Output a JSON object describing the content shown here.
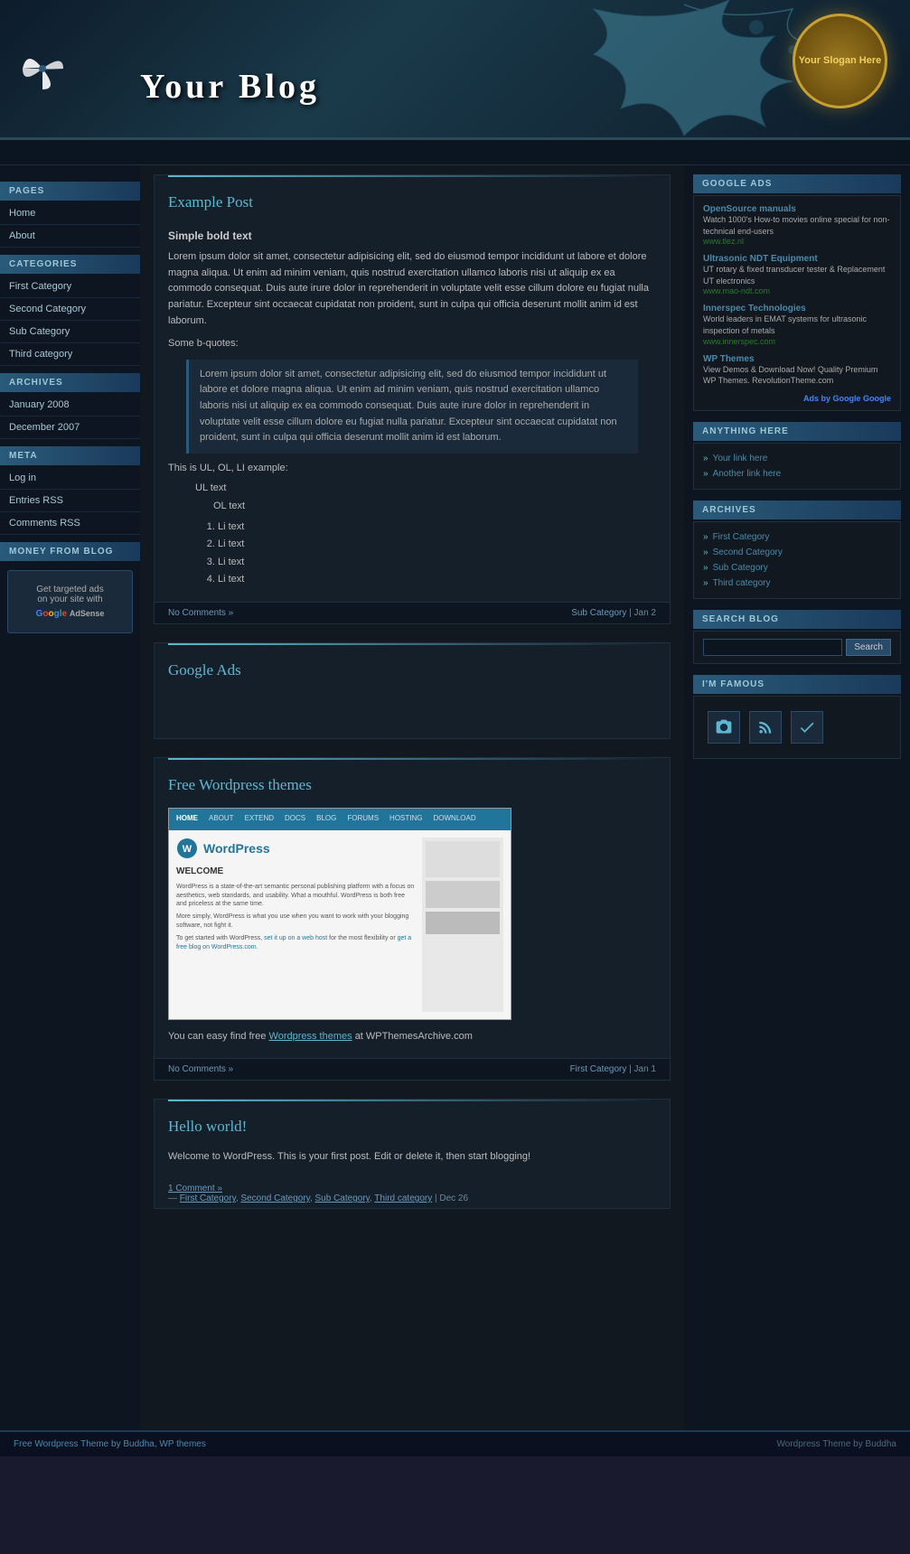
{
  "site": {
    "title": "Your Blog",
    "slogan": "Your\nSlogan\nHere"
  },
  "sidebar": {
    "pages_header": "PAGES",
    "categories_header": "CATEGORIES",
    "archives_header": "ARCHIVES",
    "meta_header": "META",
    "money_header": "MONEY FROM BLOG",
    "pages": [
      {
        "label": "Home",
        "href": "#"
      },
      {
        "label": "About",
        "href": "#"
      }
    ],
    "categories": [
      {
        "label": "First Category",
        "href": "#"
      },
      {
        "label": "Second Category",
        "href": "#"
      },
      {
        "label": "Sub Category",
        "href": "#"
      },
      {
        "label": "Third category",
        "href": "#"
      }
    ],
    "archives": [
      {
        "label": "January 2008",
        "href": "#"
      },
      {
        "label": "December 2007",
        "href": "#"
      }
    ],
    "meta": [
      {
        "label": "Log in",
        "href": "#"
      },
      {
        "label": "Entries RSS",
        "href": "#"
      },
      {
        "label": "Comments RSS",
        "href": "#"
      }
    ],
    "adsense": {
      "line1": "Get targeted ads",
      "line2": "on your site with",
      "brand": "Google AdSense"
    }
  },
  "posts": [
    {
      "title": "Example Post",
      "bold_text": "Simple bold text",
      "body1": "Lorem ipsum dolor sit amet, consectetur adipisicing elit, sed do eiusmod tempor incididunt ut labore et dolore magna aliqua. Ut enim ad minim veniam, quis nostrud exercitation ullamco laboris nisi ut aliquip ex ea commodo consequat. Duis aute irure dolor in reprehenderit in voluptate velit esse cillum dolore eu fugiat nulla pariatur. Excepteur sint occaecat cupidatat non proident, sunt in culpa qui officia deserunt mollit anim id est laborum.",
      "bquotes_label": "Some b-quotes:",
      "blockquote": "Lorem ipsum dolor sit amet, consectetur adipisicing elit, sed do eiusmod tempor incididunt ut labore et dolore magna aliqua. Ut enim ad minim veniam, quis nostrud exercitation ullamco laboris nisi ut aliquip ex ea commodo consequat. Duis aute irure dolor in reprehenderit in voluptate velit esse cillum dolore eu fugiat nulla pariatur. Excepteur sint occaecat cupidatat non proident, sunt in culpa qui officia deserunt mollit anim id est laborum.",
      "ul_label": "This is UL, OL, LI example:",
      "ul_item": "UL text",
      "ol_item": "OL text",
      "li_items": [
        "Li text",
        "Li text",
        "Li text",
        "Li text"
      ],
      "footer_comments": "No Comments »",
      "footer_category": "Sub Category",
      "footer_date": "Jan 2"
    },
    {
      "title": "Google Ads",
      "type": "ads"
    },
    {
      "title": "Free Wordpress themes",
      "body": "You can easy find free ",
      "link_text": "Wordpress themes",
      "body2": " at WPThemesArchive.com",
      "footer_comments": "No Comments »",
      "footer_category": "First Category",
      "footer_date": "Jan 1"
    },
    {
      "title": "Hello world!",
      "body": "Welcome to WordPress. This is your first post. Edit or delete it, then start blogging!",
      "footer_comments": "1 Comment »",
      "tags": [
        "First Category",
        "Second Category",
        "Sub Category",
        "Third category"
      ],
      "footer_date": "Dec 26"
    }
  ],
  "right_sidebar": {
    "google_ads_header": "GOOGLE ADS",
    "ads": [
      {
        "title": "OpenSource manuals",
        "desc": "Watch 1000's How-to movies online special for non-technical end-users",
        "url": "www.tlez.nl"
      },
      {
        "title": "Ultrasonic NDT Equipment",
        "desc": "UT rotary & fixed transducer tester & Replacement UT electronics",
        "url": "www.mao-ndt.com"
      },
      {
        "title": "Innerspec Technologies",
        "desc": "World leaders in EMAT systems for ultrasonic inspection of metals",
        "url": "www.innerspec.com"
      },
      {
        "title": "WP Themes",
        "desc": "View Demos & Download Now! Quality Premium WP Themes. RevolutionTheme.com",
        "url": ""
      }
    ],
    "ads_by_google": "Ads by Google",
    "anything_header": "ANYTHING HERE",
    "links": [
      {
        "label": "Your link here"
      },
      {
        "label": "Another link here"
      }
    ],
    "archives_header": "ARCHIVES",
    "archives": [
      {
        "label": "First Category"
      },
      {
        "label": "Second Category"
      },
      {
        "label": "Sub Category"
      },
      {
        "label": "Third category"
      }
    ],
    "search_header": "SEARCH BLOG",
    "search_placeholder": "",
    "search_button": "Search",
    "famous_header": "I'M FAMOUS"
  },
  "footer": {
    "left": "Free Wordpress Theme by Buddha, WP themes",
    "right": "Wordpress Theme by Buddha"
  }
}
